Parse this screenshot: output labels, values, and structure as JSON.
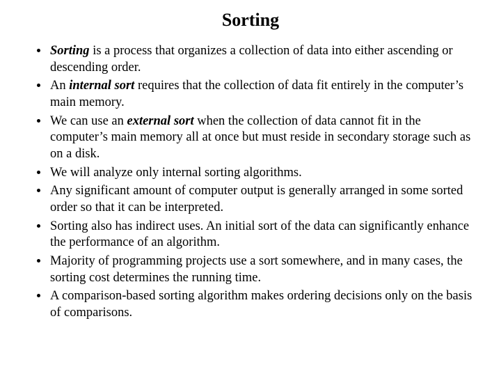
{
  "title": "Sorting",
  "bullets": {
    "b1": {
      "term": "Sorting",
      "rest": " is a process that organizes a collection of data into either ascending or descending order."
    },
    "b2": {
      "pre": "An ",
      "term": "internal sort",
      "rest": " requires that the collection of data fit entirely in the computer’s main memory."
    },
    "b3": {
      "pre": "We can use an ",
      "term": "external sort",
      "rest": "  when  the collection of data cannot fit in the computer’s main memory all at once but must reside in secondary storage such as on a disk."
    },
    "b4": "We will analyze only internal sorting algorithms.",
    "b5": "Any significant amount of computer output is generally arranged in some sorted order so that it can be interpreted.",
    "b6": "Sorting also has indirect uses. An initial sort of the data can significantly enhance the performance of an algorithm.",
    "b7": "Majority of programming projects use a sort somewhere, and in many cases, the sorting cost determines the running time.",
    "b8": "A comparison-based sorting algorithm makes ordering decisions only on the basis of comparisons."
  }
}
